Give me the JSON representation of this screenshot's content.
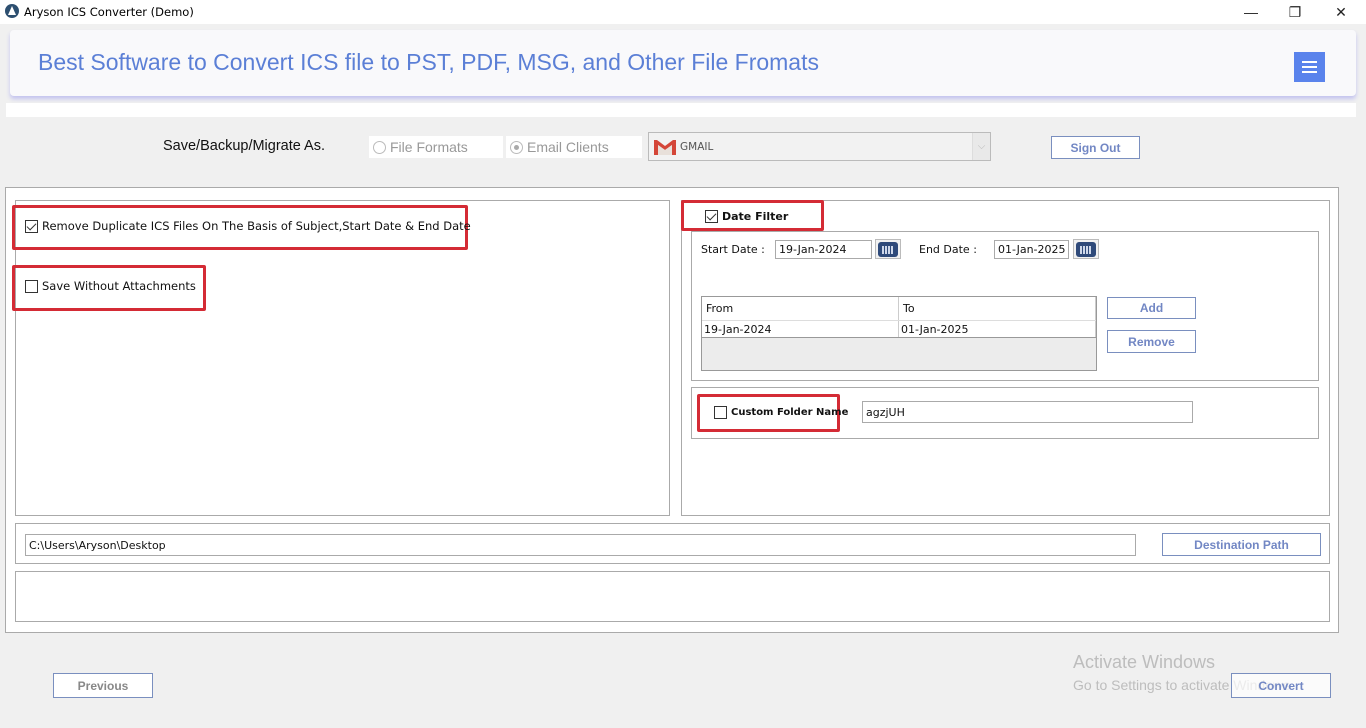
{
  "window": {
    "title": "Aryson ICS Converter (Demo)",
    "controls": {
      "minimize": "—",
      "maximize": "❐",
      "close": "✕"
    }
  },
  "header": {
    "title": "Best Software to Convert ICS file to PST, PDF, MSG, and Other File Fromats",
    "accent_color": "#5b7fd6",
    "menu_button_color": "#5a83ec"
  },
  "save_as": {
    "label": "Save/Backup/Migrate As.",
    "options": [
      {
        "label": "File Formats",
        "selected": false
      },
      {
        "label": "Email Clients",
        "selected": true
      }
    ],
    "client_select": {
      "value": "GMAIL",
      "icon": "gmail-icon"
    },
    "sign_out_label": "Sign Out"
  },
  "options": {
    "remove_duplicates": {
      "label": "Remove Duplicate ICS Files On The Basis of Subject,Start Date & End Date",
      "checked": true
    },
    "save_without_attachments": {
      "label": "Save Without Attachments",
      "checked": false
    }
  },
  "date_filter": {
    "label": "Date Filter",
    "checked": true,
    "start_label": "Start Date :",
    "start_value": "19-Jan-2024",
    "end_label": "End Date :",
    "end_value": "01-Jan-2025",
    "table": {
      "columns": [
        "From",
        "To"
      ],
      "rows": [
        [
          "19-Jan-2024",
          "01-Jan-2025"
        ]
      ]
    },
    "add_label": "Add",
    "remove_label": "Remove"
  },
  "custom_folder": {
    "label": "Custom Folder Name",
    "checked": false,
    "value": "agzjUH"
  },
  "destination": {
    "path": "C:\\Users\\Aryson\\Desktop",
    "button_label": "Destination Path"
  },
  "footer": {
    "previous_label": "Previous",
    "convert_label": "Convert"
  },
  "watermark": {
    "line1": "Activate Windows",
    "line2": "Go to Settings to activate Windows."
  },
  "highlight_color": "#d42b35"
}
